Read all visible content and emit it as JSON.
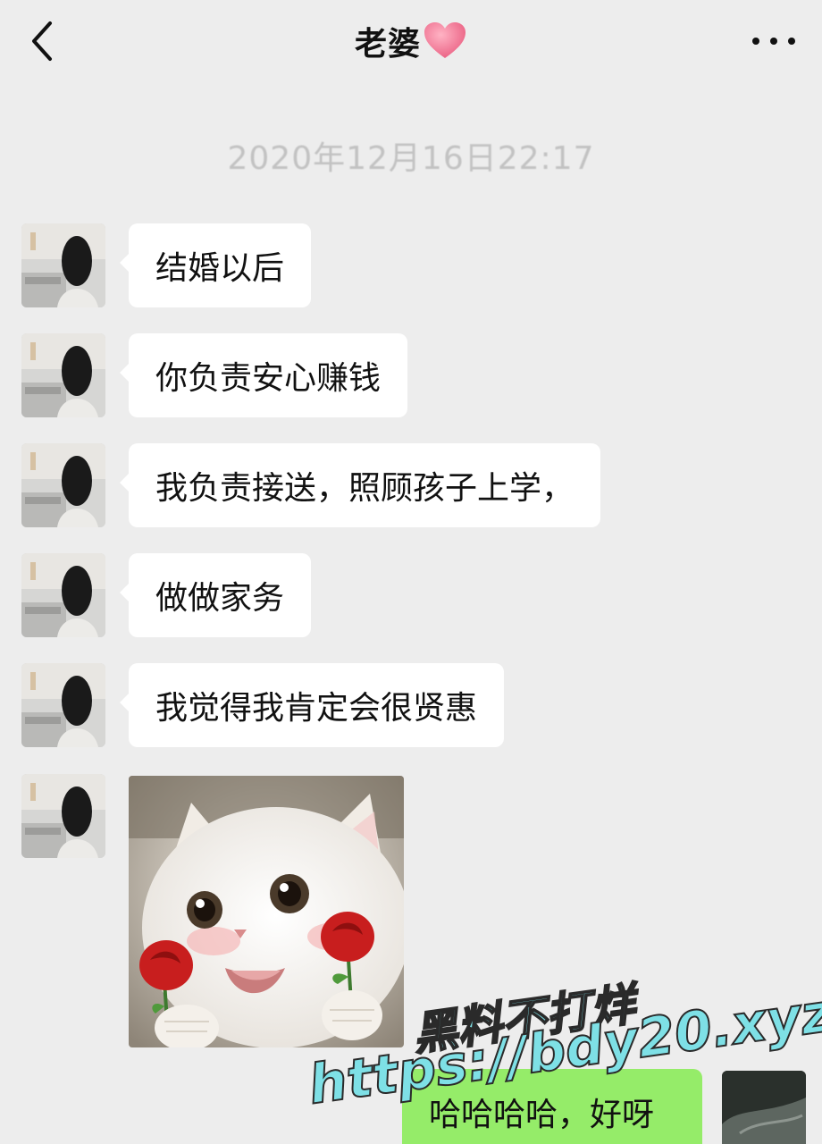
{
  "header": {
    "back_icon": "chevron-left-icon",
    "title": "老婆",
    "title_heart_icon": "pink-heart-icon",
    "more_icon": "ellipsis-icon"
  },
  "timestamp": "2020年12月16日22:17",
  "messages": [
    {
      "sender": "contact",
      "text": "结婚以后"
    },
    {
      "sender": "contact",
      "text": "你负责安心赚钱"
    },
    {
      "sender": "contact",
      "text": "我负责接送，照顾孩子上学，"
    },
    {
      "sender": "contact",
      "text": "做做家务"
    },
    {
      "sender": "contact",
      "text": "我觉得我肯定会很贤惠"
    },
    {
      "sender": "contact",
      "type": "sticker",
      "sticker": "white-kitten-holding-roses-sticker"
    },
    {
      "sender": "me",
      "text": "哈哈哈哈，好呀"
    }
  ],
  "watermark": {
    "line1": "黑料不打烊",
    "line2": "https://bdy20.xyz"
  },
  "colors": {
    "background": "#ededed",
    "contact_bubble": "#ffffff",
    "my_bubble": "#95ec69",
    "heart": "#f07a94",
    "watermark": "#7ee0e6"
  }
}
